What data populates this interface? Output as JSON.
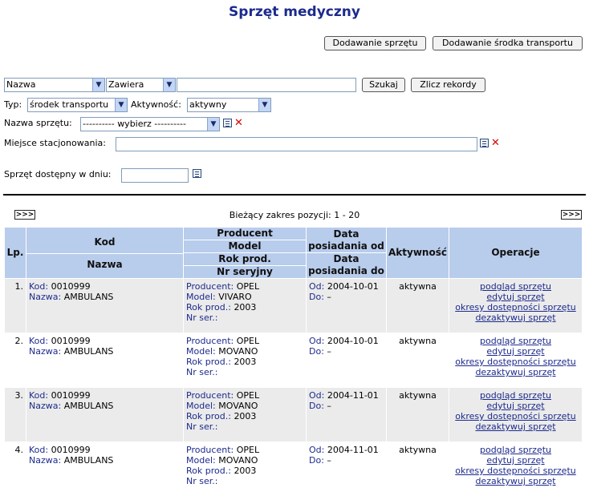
{
  "page": {
    "title": "Sprzęt medyczny"
  },
  "actions": {
    "add_equipment": "Dodawanie sprzętu",
    "add_transport": "Dodawanie środka transportu"
  },
  "search": {
    "field": "Nazwa",
    "operator": "Zawiera",
    "value": "",
    "search_button": "Szukaj",
    "count_button": "Zlicz rekordy"
  },
  "filters": {
    "type_label": "Typ:",
    "type_value": "środek transportu",
    "activity_label": "Aktywność:",
    "activity_value": "aktywny",
    "equipment_name_label": "Nazwa sprzętu:",
    "equipment_name_value": "---------- wybierz ----------",
    "location_label": "Miejsce stacjonowania:",
    "location_value": "",
    "available_label": "Sprzęt dostępny w dniu:",
    "available_value": ""
  },
  "pagination": {
    "prev": ">>>",
    "next": ">>>",
    "range_text": "Bieżący zakres pozycji: 1 - 20"
  },
  "table": {
    "headers": {
      "lp": "Lp.",
      "kod": "Kod",
      "nazwa": "Nazwa",
      "producent": "Producent",
      "model": "Model",
      "rok": "Rok prod.",
      "nr": "Nr seryjny",
      "od": "Data posiadania od",
      "do": "Data posiadania do",
      "aktywnosc": "Aktywność",
      "operacje": "Operacje"
    },
    "field_labels": {
      "kod": "Kod:",
      "nazwa": "Nazwa:",
      "producent": "Producent:",
      "model": "Model:",
      "rok": "Rok prod.:",
      "nr": "Nr ser.:",
      "od": "Od:",
      "do": "Do:"
    },
    "operations": {
      "view": "podgląd sprzętu",
      "edit": "edytuj sprzęt",
      "periods": "okresy dostępności sprzętu",
      "deactivate": "dezaktywuj sprzęt"
    },
    "rows": [
      {
        "lp": "1.",
        "kod": "0010999",
        "nazwa": "AMBULANS",
        "producent": "OPEL",
        "model": "VIVARO",
        "rok": "2003",
        "nr": "",
        "od": "2004-10-01",
        "do": "–",
        "aktywnosc": "aktywna"
      },
      {
        "lp": "2.",
        "kod": "0010999",
        "nazwa": "AMBULANS",
        "producent": "OPEL",
        "model": "MOVANO",
        "rok": "2003",
        "nr": "",
        "od": "2004-10-01",
        "do": "–",
        "aktywnosc": "aktywna"
      },
      {
        "lp": "3.",
        "kod": "0010999",
        "nazwa": "AMBULANS",
        "producent": "OPEL",
        "model": "MOVANO",
        "rok": "2003",
        "nr": "",
        "od": "2004-11-01",
        "do": "–",
        "aktywnosc": "aktywna"
      },
      {
        "lp": "4.",
        "kod": "0010999",
        "nazwa": "AMBULANS",
        "producent": "OPEL",
        "model": "MOVANO",
        "rok": "2003",
        "nr": "",
        "od": "2004-11-01",
        "do": "–",
        "aktywnosc": "aktywna"
      }
    ]
  }
}
